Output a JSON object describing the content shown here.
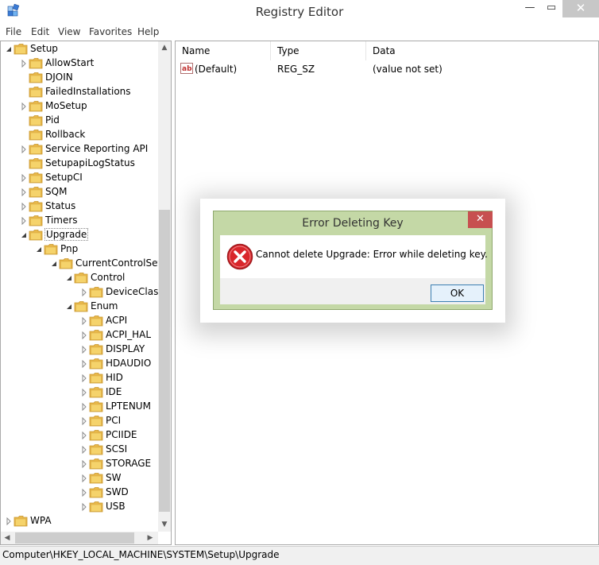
{
  "window": {
    "title": "Registry Editor",
    "minimize_glyph": "—",
    "maximize_glyph": "▭",
    "close_glyph": "✕"
  },
  "menu": [
    "File",
    "Edit",
    "View",
    "Favorites",
    "Help"
  ],
  "tree": {
    "items": [
      {
        "label": "Setup",
        "depth": 0,
        "expander": "open",
        "selected": false
      },
      {
        "label": "AllowStart",
        "depth": 1,
        "expander": "closed",
        "selected": false
      },
      {
        "label": "DJOIN",
        "depth": 1,
        "expander": "none",
        "selected": false
      },
      {
        "label": "FailedInstallations",
        "depth": 1,
        "expander": "none",
        "selected": false
      },
      {
        "label": "MoSetup",
        "depth": 1,
        "expander": "closed",
        "selected": false
      },
      {
        "label": "Pid",
        "depth": 1,
        "expander": "none",
        "selected": false
      },
      {
        "label": "Rollback",
        "depth": 1,
        "expander": "none",
        "selected": false
      },
      {
        "label": "Service Reporting API",
        "depth": 1,
        "expander": "closed",
        "selected": false
      },
      {
        "label": "SetupapiLogStatus",
        "depth": 1,
        "expander": "none",
        "selected": false
      },
      {
        "label": "SetupCI",
        "depth": 1,
        "expander": "closed",
        "selected": false
      },
      {
        "label": "SQM",
        "depth": 1,
        "expander": "closed",
        "selected": false
      },
      {
        "label": "Status",
        "depth": 1,
        "expander": "closed",
        "selected": false
      },
      {
        "label": "Timers",
        "depth": 1,
        "expander": "closed",
        "selected": false
      },
      {
        "label": "Upgrade",
        "depth": 1,
        "expander": "open",
        "selected": true
      },
      {
        "label": "Pnp",
        "depth": 2,
        "expander": "open",
        "selected": false
      },
      {
        "label": "CurrentControlSet",
        "depth": 3,
        "expander": "open",
        "selected": false
      },
      {
        "label": "Control",
        "depth": 4,
        "expander": "open",
        "selected": false
      },
      {
        "label": "DeviceClasses",
        "depth": 5,
        "expander": "closed",
        "selected": false
      },
      {
        "label": "Enum",
        "depth": 4,
        "expander": "open",
        "selected": false
      },
      {
        "label": "ACPI",
        "depth": 5,
        "expander": "closed",
        "selected": false
      },
      {
        "label": "ACPI_HAL",
        "depth": 5,
        "expander": "closed",
        "selected": false
      },
      {
        "label": "DISPLAY",
        "depth": 5,
        "expander": "closed",
        "selected": false
      },
      {
        "label": "HDAUDIO",
        "depth": 5,
        "expander": "closed",
        "selected": false
      },
      {
        "label": "HID",
        "depth": 5,
        "expander": "closed",
        "selected": false
      },
      {
        "label": "IDE",
        "depth": 5,
        "expander": "closed",
        "selected": false
      },
      {
        "label": "LPTENUM",
        "depth": 5,
        "expander": "closed",
        "selected": false
      },
      {
        "label": "PCI",
        "depth": 5,
        "expander": "closed",
        "selected": false
      },
      {
        "label": "PCIIDE",
        "depth": 5,
        "expander": "closed",
        "selected": false
      },
      {
        "label": "SCSI",
        "depth": 5,
        "expander": "closed",
        "selected": false
      },
      {
        "label": "STORAGE",
        "depth": 5,
        "expander": "closed",
        "selected": false
      },
      {
        "label": "SW",
        "depth": 5,
        "expander": "closed",
        "selected": false
      },
      {
        "label": "SWD",
        "depth": 5,
        "expander": "closed",
        "selected": false
      },
      {
        "label": "USB",
        "depth": 5,
        "expander": "closed",
        "selected": false
      },
      {
        "label": "WPA",
        "depth": 0,
        "expander": "closed",
        "selected": false
      }
    ]
  },
  "list": {
    "columns": [
      "Name",
      "Type",
      "Data"
    ],
    "rows": [
      {
        "name": "(Default)",
        "type": "REG_SZ",
        "data": "(value not set)",
        "icon": "string-value-icon"
      }
    ]
  },
  "status_bar": "Computer\\HKEY_LOCAL_MACHINE\\SYSTEM\\Setup\\Upgrade",
  "dialog": {
    "title": "Error Deleting Key",
    "message": "Cannot delete Upgrade:  Error while deleting key.",
    "ok_label": "OK",
    "close_glyph": "✕",
    "icon": "error-icon"
  },
  "colors": {
    "dialog_frame": "#c4d8a6",
    "dialog_close": "#c75050",
    "error_red": "#d9262b",
    "folder_yellow": "#f5d36b"
  }
}
